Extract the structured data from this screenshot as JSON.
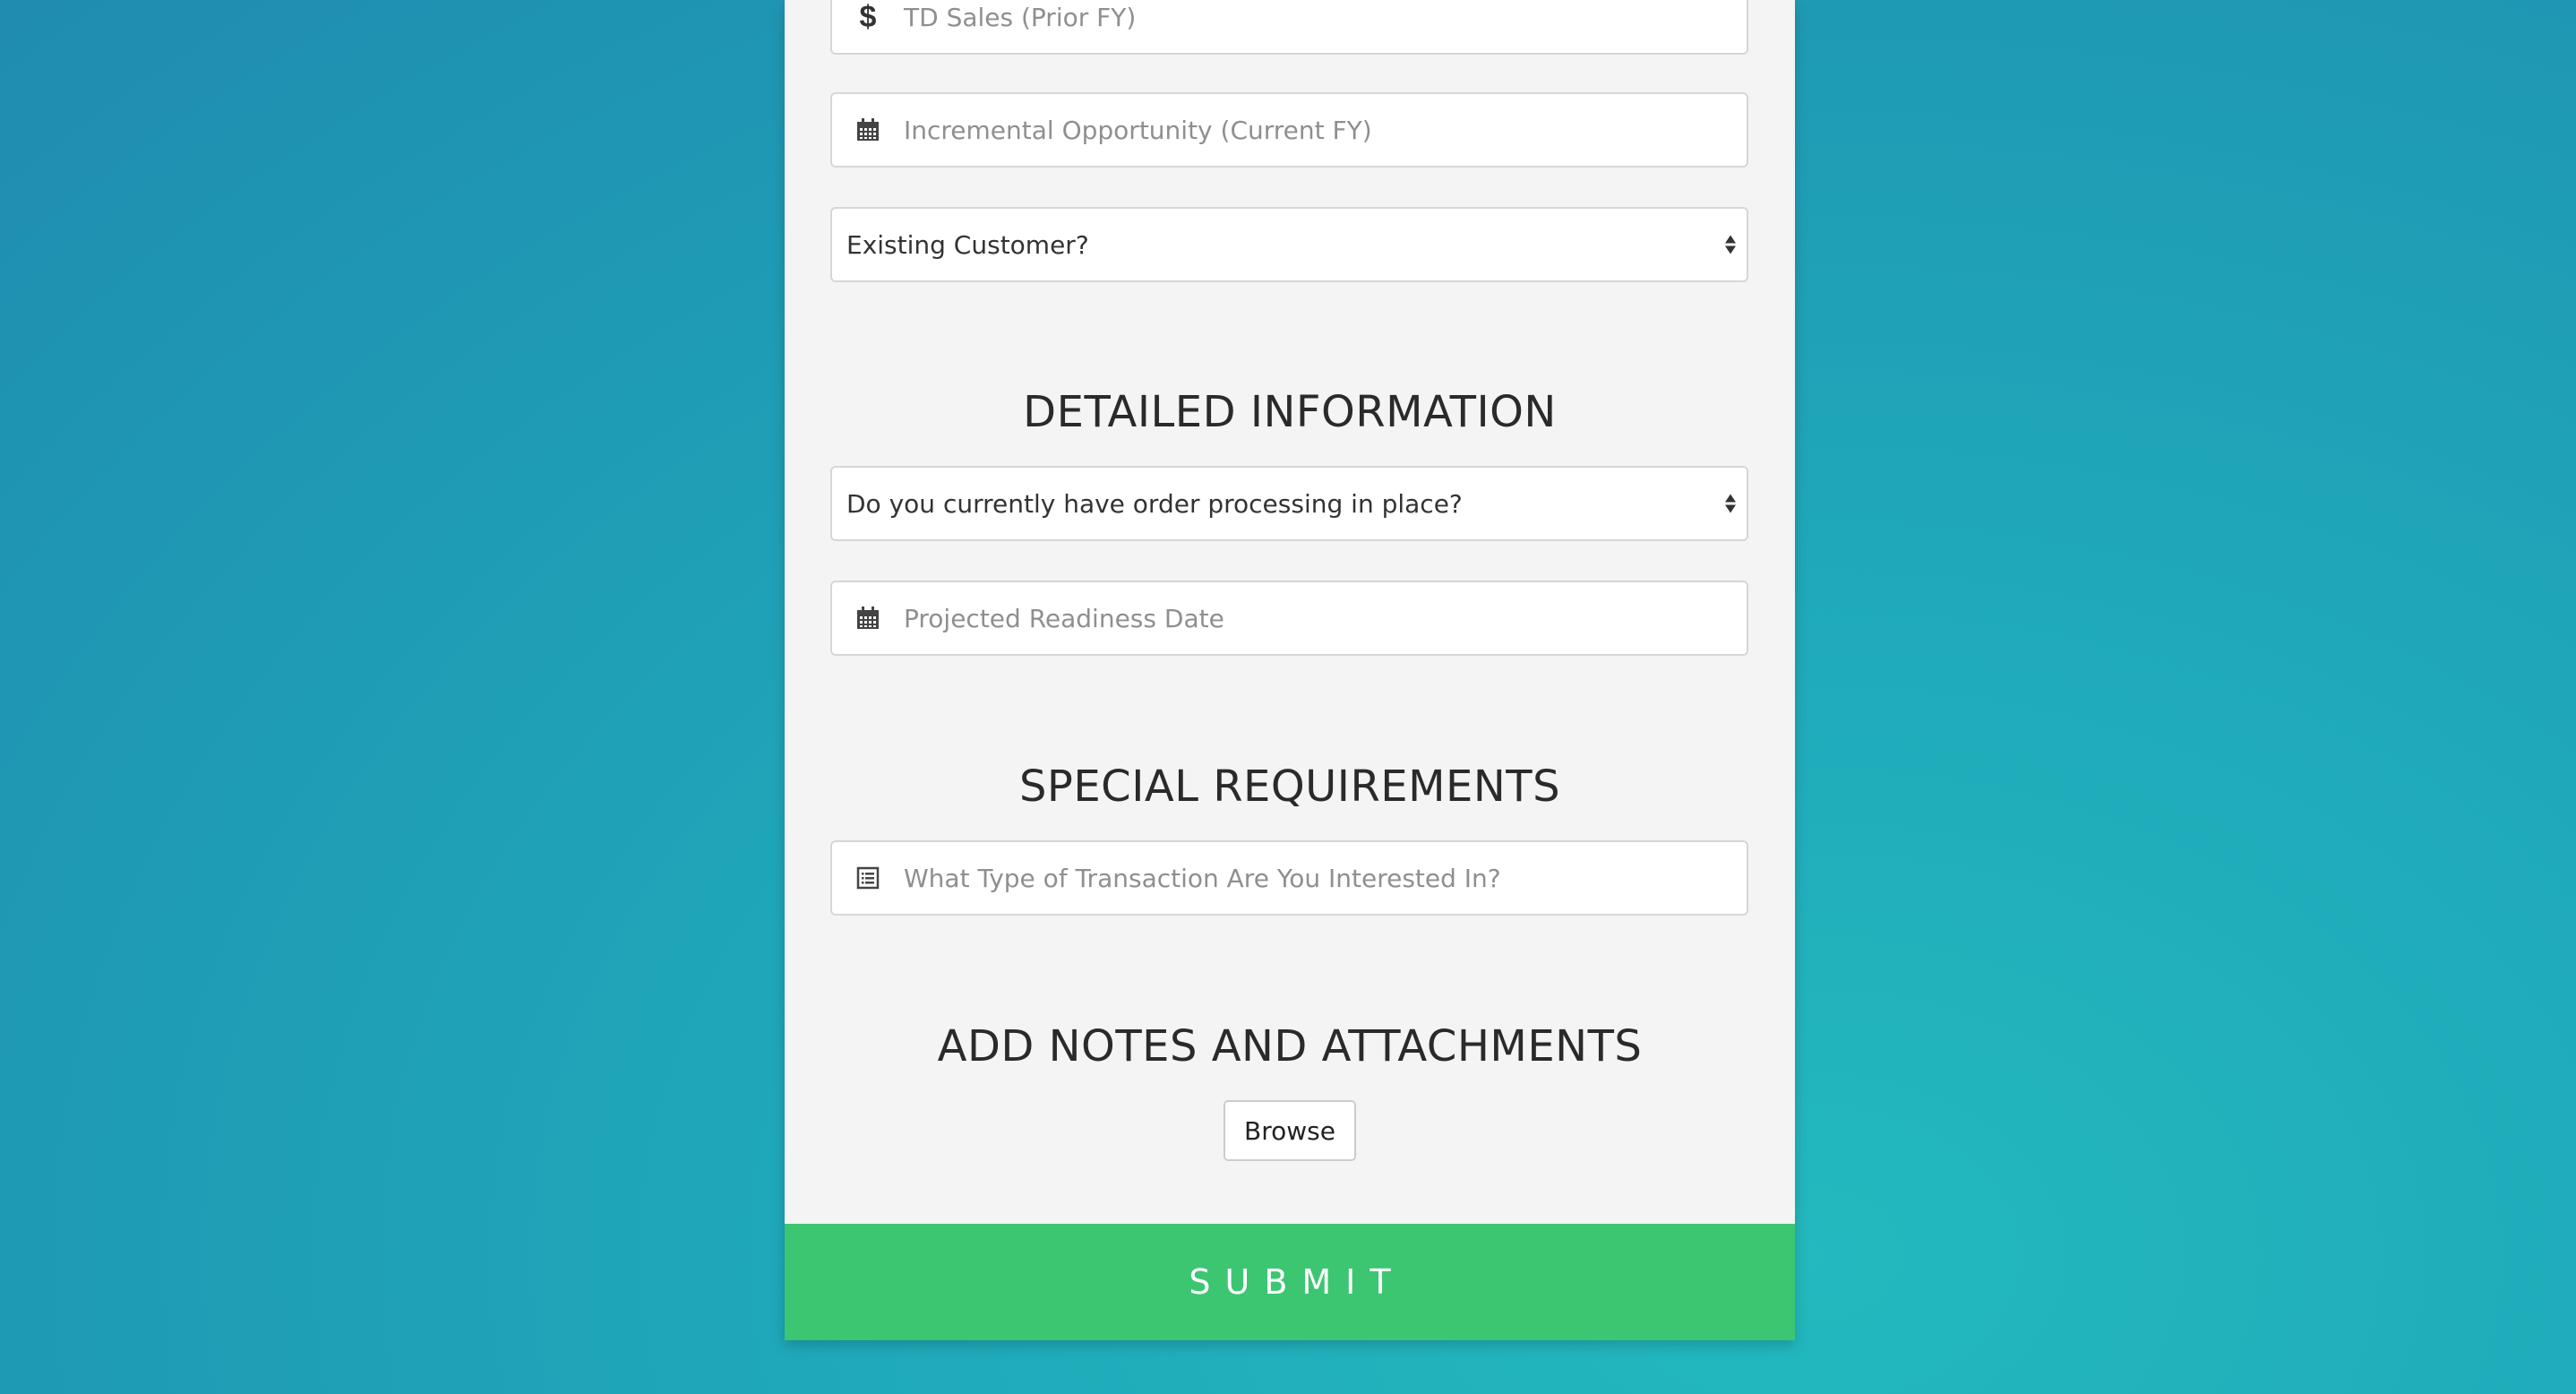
{
  "form": {
    "fields": {
      "td_sales": {
        "placeholder": "TD Sales (Prior FY)",
        "icon": "dollar-icon"
      },
      "incremental_opportunity": {
        "placeholder": "Incremental Opportunity (Current FY)",
        "icon": "calendar-icon"
      },
      "existing_customer": {
        "selected": "Existing Customer?"
      },
      "order_processing": {
        "selected": "Do you currently have order processing in place?"
      },
      "projected_readiness": {
        "placeholder": "Projected Readiness Date",
        "icon": "calendar-icon"
      },
      "transaction_type": {
        "placeholder": "What Type of Transaction Are You Interested In?",
        "icon": "list-icon"
      }
    },
    "sections": {
      "detailed": "DETAILED INFORMATION",
      "special": "SPECIAL REQUIREMENTS",
      "notes": "ADD NOTES AND ATTACHMENTS"
    },
    "browse_label": "Browse",
    "submit_label": "SUBMIT"
  },
  "colors": {
    "background": "#1f9ab5",
    "card": "#f4f4f4",
    "submit": "#3cc672"
  }
}
